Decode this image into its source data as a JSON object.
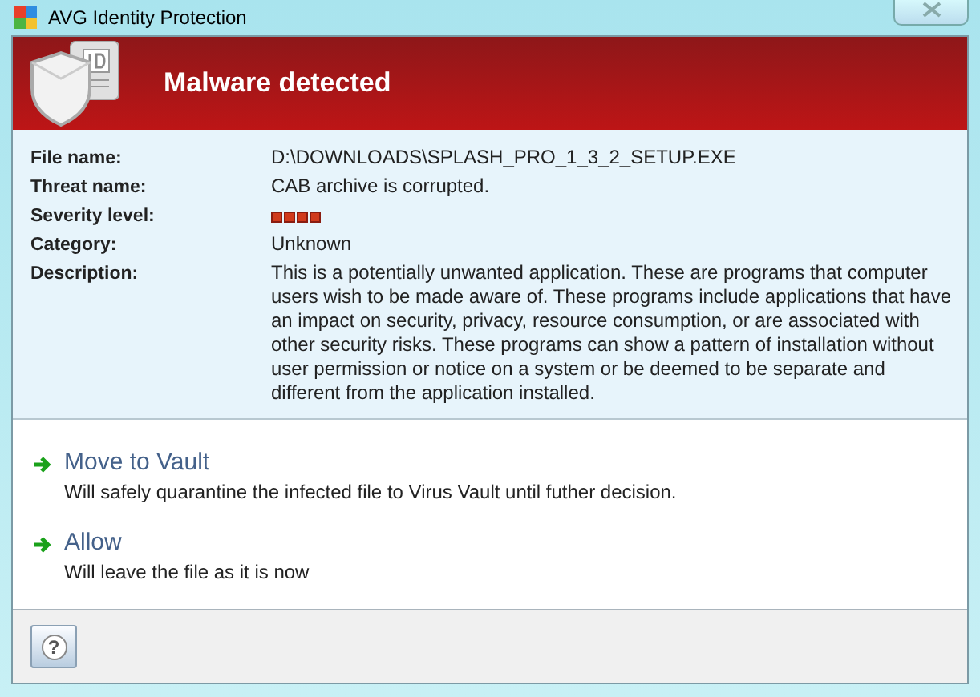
{
  "window": {
    "title": "AVG Identity Protection"
  },
  "header": {
    "title": "Malware detected"
  },
  "details": [
    {
      "kind": "text",
      "label": "File name:",
      "value": "D:\\DOWNLOADS\\SPLASH_PRO_1_3_2_SETUP.EXE"
    },
    {
      "kind": "text",
      "label": "Threat name:",
      "value": "CAB archive is corrupted."
    },
    {
      "kind": "severity",
      "label": "Severity level:",
      "stars": 4
    },
    {
      "kind": "text",
      "label": "Category:",
      "value": "Unknown"
    },
    {
      "kind": "text",
      "label": "Description:",
      "value": "This is a potentially unwanted application. These are programs that computer users wish to be made aware of. These programs include applications that have an impact on security, privacy, resource consumption, or are associated with other security risks. These programs can show a pattern of installation without user permission or notice on a system or be deemed to be separate and different from the application installed."
    }
  ],
  "actions": [
    {
      "title": "Move to Vault",
      "description": "Will safely quarantine the infected file to Virus Vault until futher decision."
    },
    {
      "title": "Allow",
      "description": "Will leave the file as it is now"
    }
  ],
  "help_button": "?"
}
